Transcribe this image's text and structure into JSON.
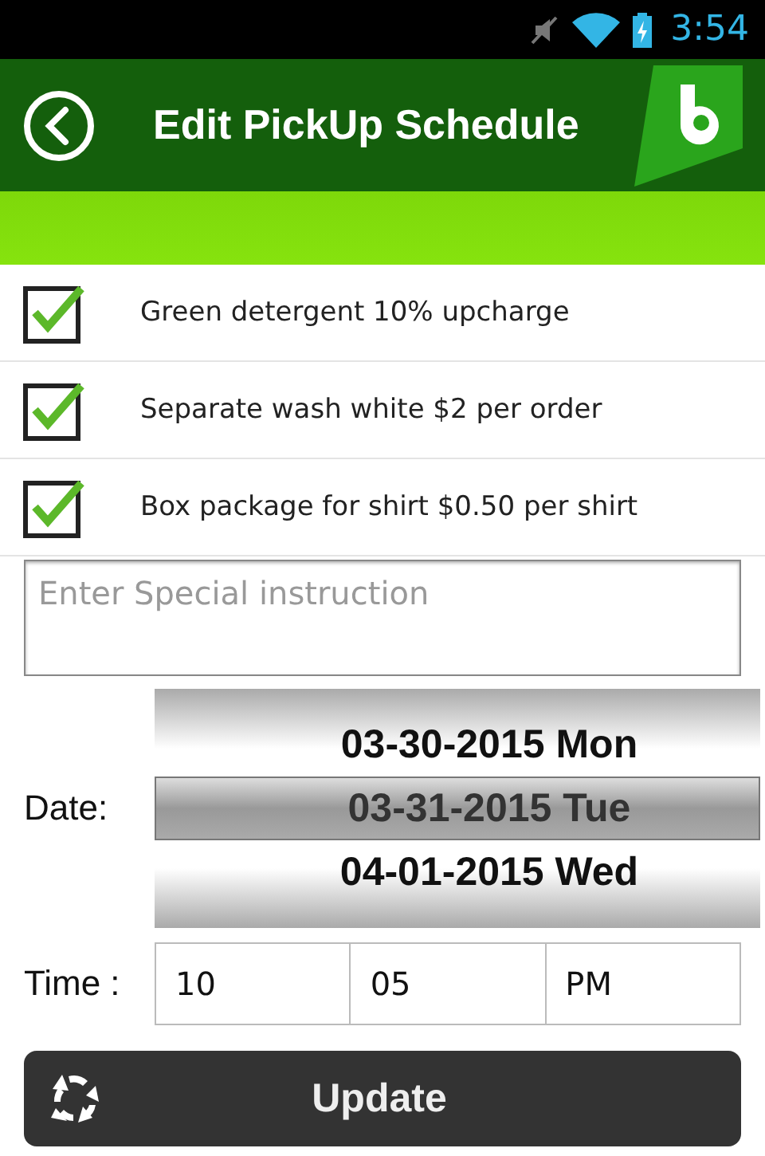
{
  "status_bar": {
    "time": "3:54"
  },
  "header": {
    "title": "Edit PickUp Schedule"
  },
  "options": [
    {
      "label": "Green detergent 10% upcharge",
      "checked": true
    },
    {
      "label": "Separate wash white $2 per order",
      "checked": true
    },
    {
      "label": "Box package for shirt $0.50 per shirt",
      "checked": true
    }
  ],
  "instructions": {
    "placeholder": "Enter Special instruction"
  },
  "date": {
    "label": "Date:",
    "items": [
      {
        "text": "03-30-2015 Mon",
        "selected": false
      },
      {
        "text": "03-31-2015 Tue",
        "selected": true
      },
      {
        "text": "04-01-2015 Wed",
        "selected": false
      }
    ]
  },
  "time": {
    "label": "Time :",
    "fields": [
      "10",
      "05",
      "PM"
    ]
  },
  "update_button": {
    "label": "Update"
  }
}
